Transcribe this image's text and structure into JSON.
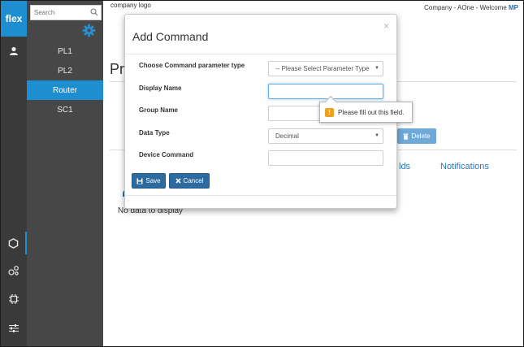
{
  "rail": {
    "logo": "flex",
    "icons": [
      "user-icon",
      "hexagon-icon",
      "circles-icon",
      "chip-icon",
      "sliders-icon"
    ]
  },
  "sidebar": {
    "search_placeholder": "Search",
    "items": [
      {
        "label": "PL1"
      },
      {
        "label": "PL2"
      },
      {
        "label": "Router"
      },
      {
        "label": "SC1"
      }
    ],
    "active_item": "Router"
  },
  "header": {
    "company_logo": "company logo",
    "welcome_text": "Company - AOne - Welcome",
    "user_initials": "MP"
  },
  "main": {
    "title_partial": "Pr",
    "delete_label": "Delete",
    "tab_fields_partial": "lds",
    "tab_notifications": "Notifications",
    "no_data": "No data to display"
  },
  "modal": {
    "title": "Add Command",
    "close_symbol": "×",
    "fields": [
      {
        "label": "Choose Command parameter type",
        "value": "-- Please Select Parameter Type"
      },
      {
        "label": "Display Name",
        "value": ""
      },
      {
        "label": "Group Name",
        "value": ""
      },
      {
        "label": "Data Type",
        "value": "Decimal"
      },
      {
        "label": "Device Command",
        "value": ""
      }
    ],
    "save_label": "Save",
    "cancel_label": "Cancel"
  },
  "tooltip": {
    "text": "Please fill out this field.",
    "icon": "!"
  },
  "colors": {
    "accent": "#1d8fd0",
    "rail_bg": "#3a3a3a",
    "sidebar_bg": "#474747",
    "button_primary": "#2c6a9f",
    "delete_button": "#6ea9d8",
    "link": "#2a78bd",
    "warning": "#f0a020"
  }
}
